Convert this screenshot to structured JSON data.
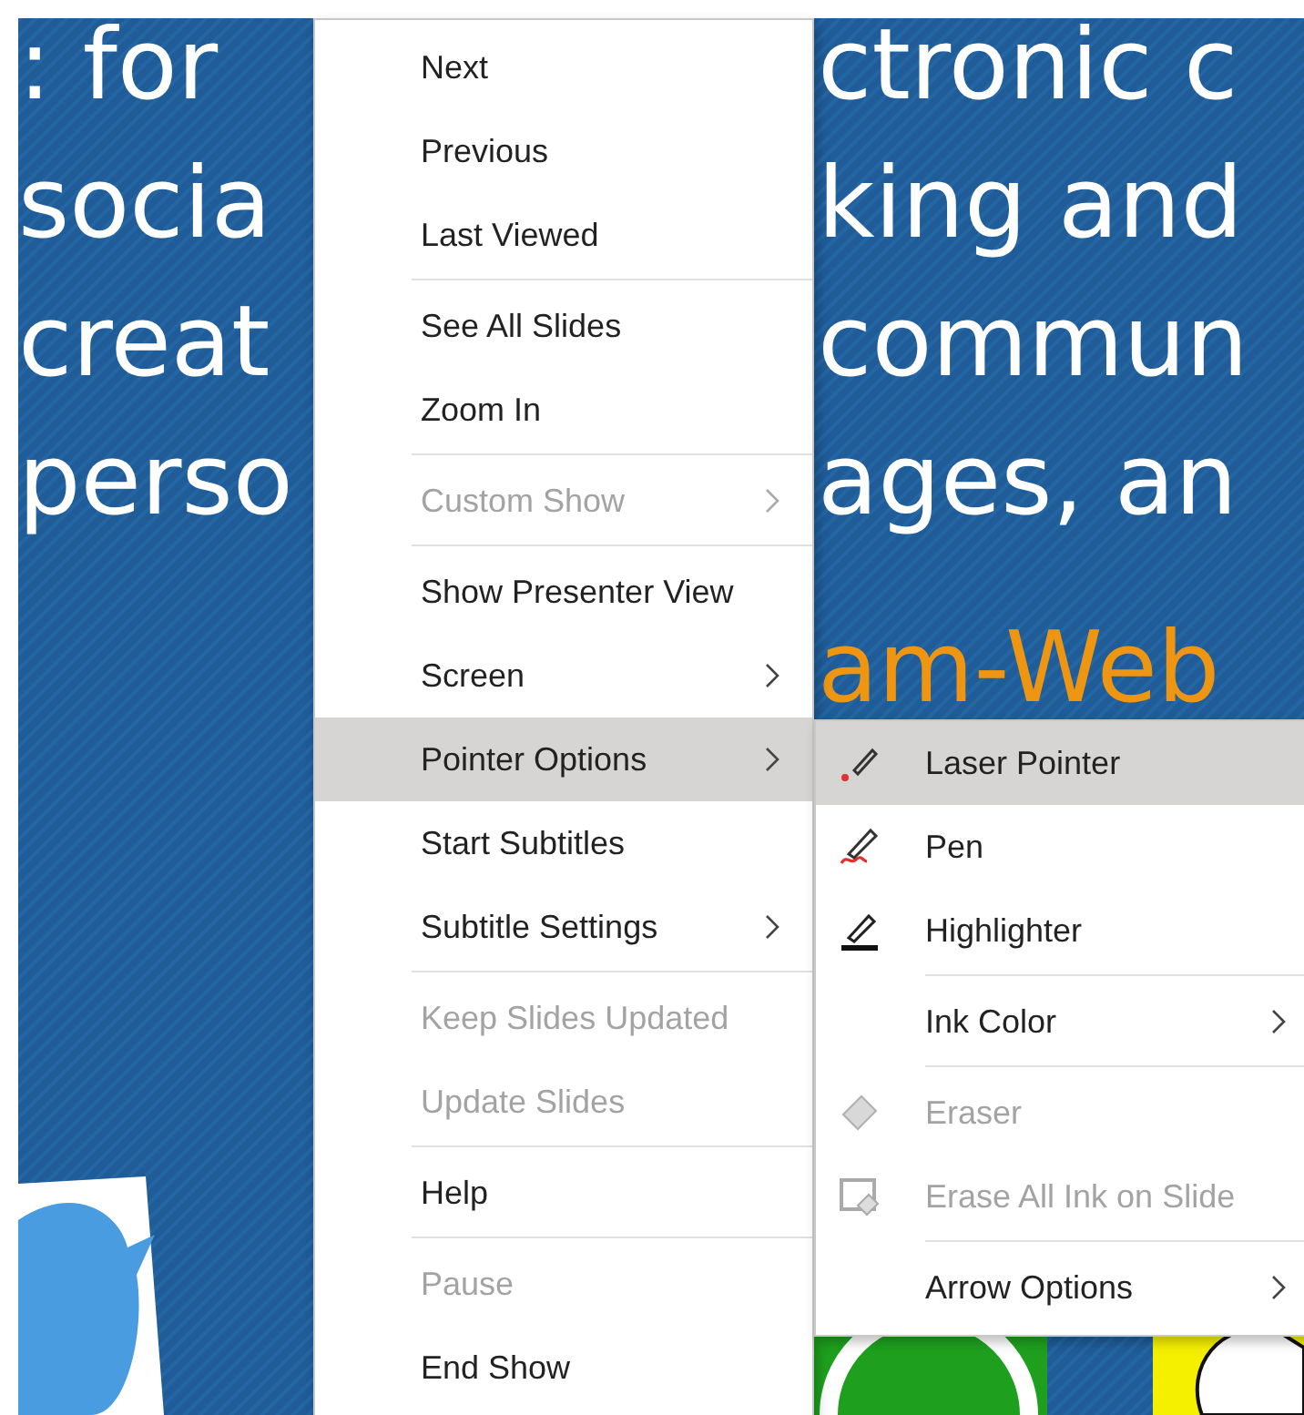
{
  "slide": {
    "lines": [
      {
        "left": ": for",
        "right": "ctronic c"
      },
      {
        "left": "socia",
        "right": "king and"
      },
      {
        "left": "creat",
        "right": "commun"
      },
      {
        "left": "perso",
        "right": "ages, an"
      }
    ],
    "accent_text": "am-Web"
  },
  "context_menu": {
    "items": [
      {
        "kind": "item",
        "label": "Next",
        "disabled": false,
        "selected": false,
        "submenu": false
      },
      {
        "kind": "item",
        "label": "Previous",
        "disabled": false,
        "selected": false,
        "submenu": false
      },
      {
        "kind": "item",
        "label": "Last Viewed",
        "disabled": false,
        "selected": false,
        "submenu": false
      },
      {
        "kind": "separator"
      },
      {
        "kind": "item",
        "label": "See All Slides",
        "disabled": false,
        "selected": false,
        "submenu": false
      },
      {
        "kind": "item",
        "label": "Zoom In",
        "disabled": false,
        "selected": false,
        "submenu": false
      },
      {
        "kind": "separator"
      },
      {
        "kind": "item",
        "label": "Custom Show",
        "disabled": true,
        "selected": false,
        "submenu": true
      },
      {
        "kind": "separator"
      },
      {
        "kind": "item",
        "label": "Show Presenter View",
        "disabled": false,
        "selected": false,
        "submenu": false
      },
      {
        "kind": "item",
        "label": "Screen",
        "disabled": false,
        "selected": false,
        "submenu": true
      },
      {
        "kind": "item",
        "label": "Pointer Options",
        "disabled": false,
        "selected": true,
        "submenu": true
      },
      {
        "kind": "item",
        "label": "Start Subtitles",
        "disabled": false,
        "selected": false,
        "submenu": false
      },
      {
        "kind": "item",
        "label": "Subtitle Settings",
        "disabled": false,
        "selected": false,
        "submenu": true
      },
      {
        "kind": "separator"
      },
      {
        "kind": "item",
        "label": "Keep Slides Updated",
        "disabled": true,
        "selected": false,
        "submenu": false
      },
      {
        "kind": "item",
        "label": "Update Slides",
        "disabled": true,
        "selected": false,
        "submenu": false
      },
      {
        "kind": "separator"
      },
      {
        "kind": "item",
        "label": "Help",
        "disabled": false,
        "selected": false,
        "submenu": false
      },
      {
        "kind": "separator"
      },
      {
        "kind": "item",
        "label": "Pause",
        "disabled": true,
        "selected": false,
        "submenu": false
      },
      {
        "kind": "item",
        "label": "End Show",
        "disabled": false,
        "selected": false,
        "submenu": false
      }
    ]
  },
  "pointer_submenu": {
    "items": [
      {
        "kind": "laser",
        "label": "Laser Pointer",
        "disabled": false,
        "selected": true,
        "submenu": false
      },
      {
        "kind": "pen",
        "label": "Pen",
        "disabled": false,
        "selected": false,
        "submenu": false
      },
      {
        "kind": "highlighter",
        "label": "Highlighter",
        "disabled": false,
        "selected": false,
        "submenu": false
      },
      {
        "kind": "separator"
      },
      {
        "kind": "plain",
        "label": "Ink Color",
        "disabled": false,
        "selected": false,
        "submenu": true
      },
      {
        "kind": "separator"
      },
      {
        "kind": "eraser",
        "label": "Eraser",
        "disabled": true,
        "selected": false,
        "submenu": false
      },
      {
        "kind": "clear",
        "label": "Erase All Ink on Slide",
        "disabled": true,
        "selected": false,
        "submenu": false
      },
      {
        "kind": "separator"
      },
      {
        "kind": "plain",
        "label": "Arrow Options",
        "disabled": false,
        "selected": false,
        "submenu": true
      }
    ]
  }
}
